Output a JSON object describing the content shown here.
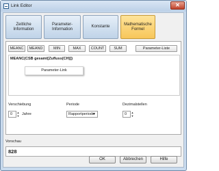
{
  "window": {
    "title": "Link Editor",
    "close_glyph": "✕"
  },
  "tabs": [
    {
      "label": "Zeitliche Information",
      "active": false
    },
    {
      "label": "Parameter-Information",
      "active": false
    },
    {
      "label": "Konstante",
      "active": false
    },
    {
      "label": "Mathematische Formel",
      "active": true
    }
  ],
  "functions": [
    "MEANC",
    "MEAND",
    "MIN",
    "MAX",
    "COUNT",
    "SUM"
  ],
  "parameter_list_button": "Parameter-Liste",
  "formula": {
    "text": "MEANC(CSB gesamt[Zufluss(CH)])",
    "popup_button": "Parameter-Link"
  },
  "verschiebung": {
    "label": "Verschiebung",
    "value": "0",
    "unit": "Jahre"
  },
  "periode": {
    "label": "Periode",
    "value": "Rapportperiode"
  },
  "dezimalstellen": {
    "label": "Dezimalstellen",
    "value": "0"
  },
  "vorschau": {
    "label": "Vorschau",
    "value": "828"
  },
  "buttons": {
    "ok": "OK",
    "cancel": "Abbrechen",
    "help": "Hilfe"
  },
  "icons": {
    "spin": "spin-arrows-icon",
    "dropdown": "chevron-down-icon",
    "app": "app-icon"
  },
  "colors": {
    "active_tab": "#f7c65a",
    "tab": "#bfd3e8",
    "window_frame": "#c9dbee"
  }
}
